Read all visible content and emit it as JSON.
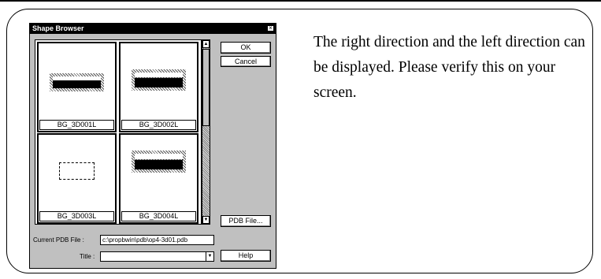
{
  "dialog": {
    "title": "Shape Browser",
    "close_glyph": "×",
    "tiles": [
      {
        "label": "BG_3D001L"
      },
      {
        "label": "BG_3D002L"
      },
      {
        "label": "BG_3D003L"
      },
      {
        "label": "BG_3D004L"
      }
    ],
    "buttons": {
      "ok": "OK",
      "cancel": "Cancel",
      "pdb_file": "PDB File...",
      "help": "Help"
    },
    "fields": {
      "current_pdb_label": "Current PDB File :",
      "current_pdb_value": "c:\\propbwin\\pdb\\op4-3d01.pdb",
      "title_label": "Title :",
      "title_value": ""
    },
    "scroll": {
      "up_glyph": "▲",
      "down_glyph": "▼"
    }
  },
  "description": "The right direction and the left direction can be displayed. Please verify this on your screen."
}
